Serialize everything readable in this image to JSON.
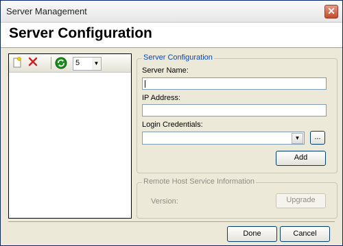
{
  "window": {
    "title": "Server Management"
  },
  "header": {
    "title": "Server Configuration"
  },
  "toolbar": {
    "new_icon": "new-document-icon",
    "delete_icon": "delete-icon",
    "refresh_icon": "refresh-icon",
    "refresh_interval": "5"
  },
  "server_config": {
    "legend": "Server Configuration",
    "server_name_label": "Server Name:",
    "server_name_value": "",
    "ip_label": "IP Address:",
    "ip_value": "",
    "login_label": "Login Credentials:",
    "login_value": "",
    "browse_label": "...",
    "add_label": "Add"
  },
  "remote_host": {
    "legend": "Remote Host Service Information",
    "version_label": "Version:",
    "upgrade_label": "Upgrade"
  },
  "footer": {
    "done_label": "Done",
    "cancel_label": "Cancel"
  }
}
